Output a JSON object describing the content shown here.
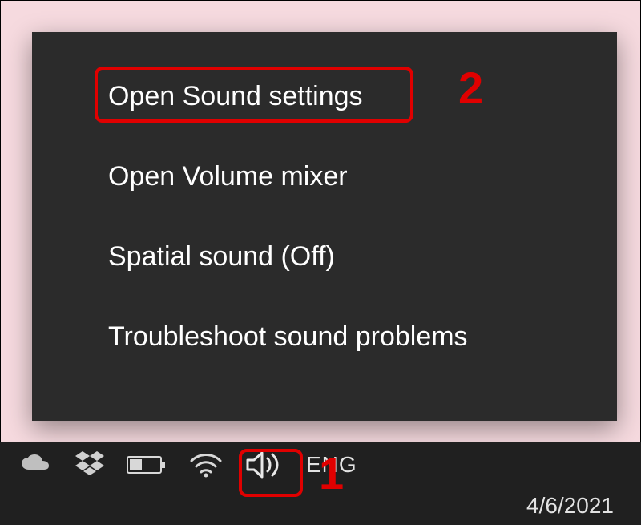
{
  "context_menu": {
    "items": [
      {
        "label": "Open Sound settings"
      },
      {
        "label": "Open Volume mixer"
      },
      {
        "label": "Spatial sound (Off)"
      },
      {
        "label": "Troubleshoot sound problems"
      }
    ]
  },
  "taskbar": {
    "language_label": "ENG",
    "date_text": "4/6/2021"
  },
  "annotations": {
    "step1": "1",
    "step2": "2"
  },
  "colors": {
    "annotation": "#e00000",
    "menu_bg": "#2b2b2b",
    "page_bg": "#f6dadf"
  }
}
